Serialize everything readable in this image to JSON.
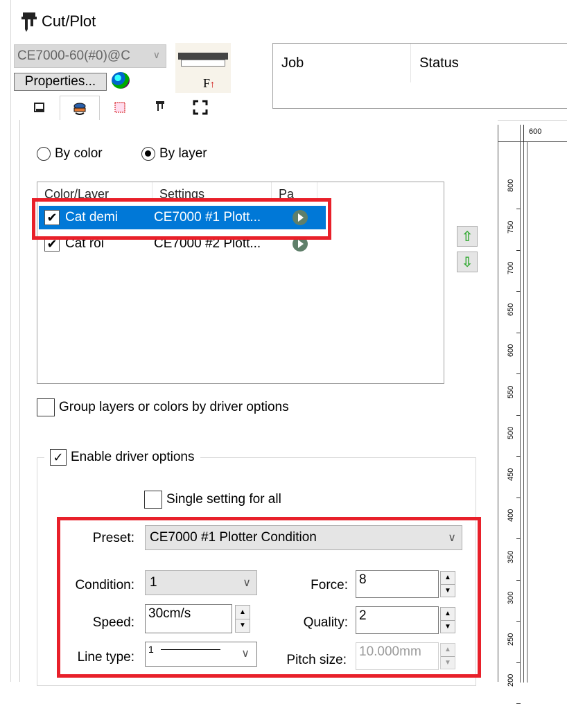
{
  "window": {
    "title": "Cut/Plot",
    "icon": "cutter-icon"
  },
  "device": {
    "selected": "CE7000-60(#0)@C",
    "properties_label": "Properties..."
  },
  "job_list": {
    "columns": [
      "Job",
      "Status"
    ]
  },
  "tabs": [
    {
      "icon": "layout-tab-icon"
    },
    {
      "icon": "layer-tab-icon"
    },
    {
      "icon": "registration-tab-icon"
    },
    {
      "icon": "blade-tab-icon"
    },
    {
      "icon": "fullscreen-tab-icon"
    }
  ],
  "mode": {
    "by_color": "By color",
    "by_layer": "By layer",
    "selected": "by_layer"
  },
  "layers": {
    "headers": [
      "Color/Layer",
      "Settings",
      "Pa"
    ],
    "rows": [
      {
        "name": "Cat demi",
        "settings": "CE7000 #1 Plott...",
        "checked": true,
        "selected": true
      },
      {
        "name": "Cat roi",
        "settings": "CE7000 #2 Plott...",
        "checked": true,
        "selected": false
      }
    ]
  },
  "group_layers_label": "Group layers or colors by driver options",
  "enable_driver_label": "Enable driver options",
  "single_setting_label": "Single setting for all",
  "driver": {
    "preset_label": "Preset:",
    "preset_value": "CE7000 #1 Plotter Condition",
    "condition_label": "Condition:",
    "condition_value": "1",
    "force_label": "Force:",
    "force_value": "8",
    "speed_label": "Speed:",
    "speed_value": "30cm/s",
    "quality_label": "Quality:",
    "quality_value": "2",
    "line_type_label": "Line type:",
    "line_type_value": "1",
    "pitch_label": "Pitch size:",
    "pitch_value": "10.000mm"
  },
  "ruler": {
    "top": "600",
    "marks": [
      "800",
      "750",
      "700",
      "650",
      "600",
      "550",
      "500",
      "450",
      "400",
      "350",
      "300",
      "250",
      "200"
    ]
  },
  "colors": {
    "selection": "#0078d7",
    "highlight_box": "#e8202a"
  }
}
